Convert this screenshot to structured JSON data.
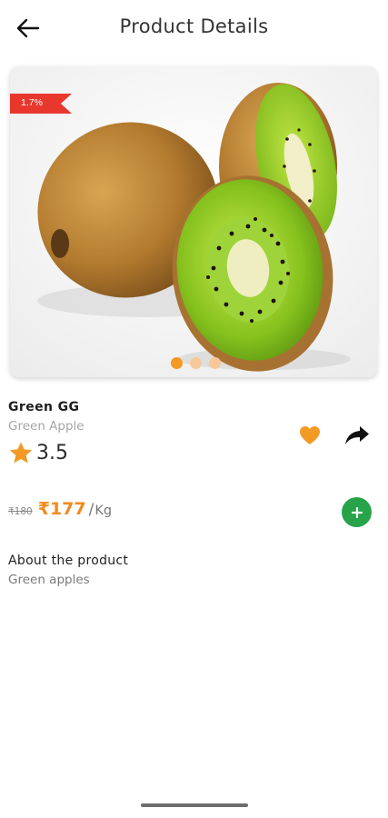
{
  "header": {
    "title": "Product Details",
    "back_icon": "arrow-left-icon"
  },
  "product": {
    "discount_badge": "1.7%",
    "image_alt": "Kiwi fruits",
    "carousel": {
      "count": 3,
      "active_index": 0
    },
    "name": "Green GG",
    "variety": "Green Apple",
    "rating": "3.5",
    "old_price": "₹180",
    "price": "₹177",
    "unit_separator": "/",
    "unit": "Kg"
  },
  "actions": {
    "favorite_icon": "heart-icon",
    "share_icon": "share-icon",
    "add_icon": "plus-icon"
  },
  "about": {
    "title": "About the product",
    "text": "Green apples"
  },
  "colors": {
    "accent": "#f29a24",
    "price": "#f08a1c",
    "badge": "#e8382e",
    "add_button": "#27a34a",
    "dot_inactive": "#f7c99a"
  }
}
